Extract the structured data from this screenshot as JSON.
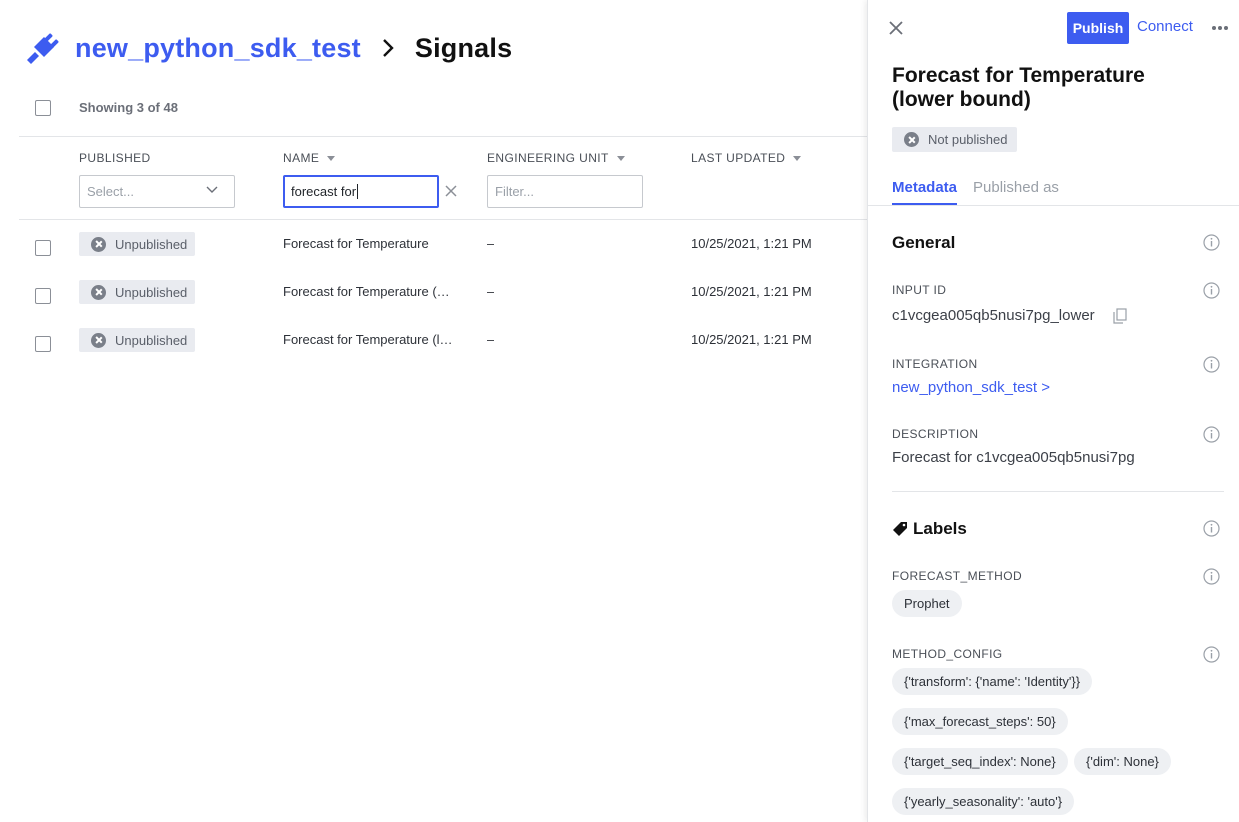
{
  "header": {
    "integration_name": "new_python_sdk_test",
    "page_title": "Signals"
  },
  "table": {
    "count_text": "Showing 3 of 48",
    "columns": {
      "published": "PUBLISHED",
      "name": "NAME",
      "engineering_unit": "ENGINEERING UNIT",
      "last_updated": "LAST UPDATED"
    },
    "filters": {
      "published_placeholder": "Select...",
      "name_value": "forecast for",
      "unit_placeholder": "Filter..."
    },
    "rows": [
      {
        "status": "Unpublished",
        "name": "Forecast for Temperature",
        "unit": "–",
        "updated": "10/25/2021, 1:21 PM"
      },
      {
        "status": "Unpublished",
        "name": "Forecast for Temperature (…",
        "unit": "–",
        "updated": "10/25/2021, 1:21 PM"
      },
      {
        "status": "Unpublished",
        "name": "Forecast for Temperature (l…",
        "unit": "–",
        "updated": "10/25/2021, 1:21 PM"
      }
    ]
  },
  "panel": {
    "publish_label": "Publish",
    "connect_label": "Connect",
    "title": "Forecast for Temperature (lower bound)",
    "status": "Not published",
    "tabs": [
      "Metadata",
      "Published as"
    ],
    "general": {
      "title": "General",
      "input_id_label": "INPUT ID",
      "input_id_value": "c1vcgea005qb5nusi7pg_lower",
      "integration_label": "INTEGRATION",
      "integration_value": "new_python_sdk_test >",
      "description_label": "DESCRIPTION",
      "description_value": "Forecast for c1vcgea005qb5nusi7pg"
    },
    "labels": {
      "title": "Labels",
      "forecast_method_label": "FORECAST_METHOD",
      "forecast_method_value": "Prophet",
      "method_config_label": "METHOD_CONFIG",
      "method_config_values": [
        "{'transform': {'name': 'Identity'}}",
        "{'max_forecast_steps': 50}",
        "{'target_seq_index': None}",
        "{'dim': None}",
        "{'yearly_seasonality': 'auto'}"
      ]
    }
  },
  "colors": {
    "accent": "#3d5cf0",
    "badge_bg": "#e9ebf0",
    "chip_bg": "#eef0f3"
  }
}
